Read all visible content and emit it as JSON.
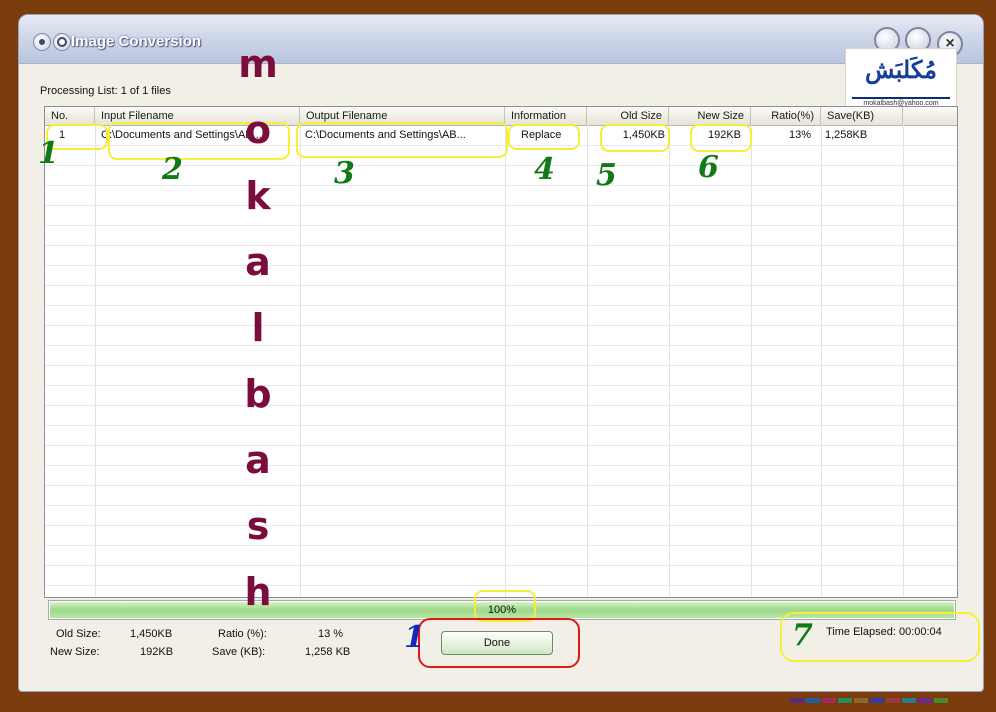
{
  "window": {
    "title": "Image Conversion",
    "close_glyph": "×"
  },
  "logo": {
    "arabic_text": "مُكَلبَش",
    "email": "mokalbash@yahoo.com"
  },
  "processing_label": "Processing List: 1 of 1 files",
  "table": {
    "columns": [
      "No.",
      "Input Filename",
      "Output Filename",
      "Information",
      "Old Size",
      "New Size",
      "Ratio(%)",
      "Save(KB)"
    ],
    "rows": [
      {
        "no": "1",
        "input": "C:\\Documents and Settings\\AB...",
        "output": "C:\\Documents and Settings\\AB...",
        "info": "Replace",
        "old_size": "1,450KB",
        "new_size": "192KB",
        "ratio": "13%",
        "save": "1,258KB"
      }
    ]
  },
  "progress": {
    "value": 1.0,
    "label": "100%"
  },
  "stats": {
    "old_size_label": "Old Size:",
    "old_size_value": "1,450KB",
    "new_size_label": "New Size:",
    "new_size_value": "192KB",
    "ratio_label": "Ratio (%):",
    "ratio_value": "13 %",
    "save_label": "Save (KB):",
    "save_value": "1,258 KB"
  },
  "done_button": "Done",
  "time_elapsed": "Time Elapsed: 00:00:04",
  "annotations": {
    "numbers": [
      "1",
      "2",
      "3",
      "4",
      "5",
      "6",
      "7",
      "1"
    ],
    "watermark_letters": [
      "m",
      "o",
      "k",
      "a",
      "l",
      "b",
      "a",
      "s",
      "h"
    ],
    "highlight_color": "#f5ef3a",
    "button_highlight_color": "#e01818",
    "number_color": "#127a14",
    "number_color_blue": "#1328b8"
  },
  "colors": {
    "frame": "#7a3c0c",
    "progress_fill": "#9ed88a"
  }
}
